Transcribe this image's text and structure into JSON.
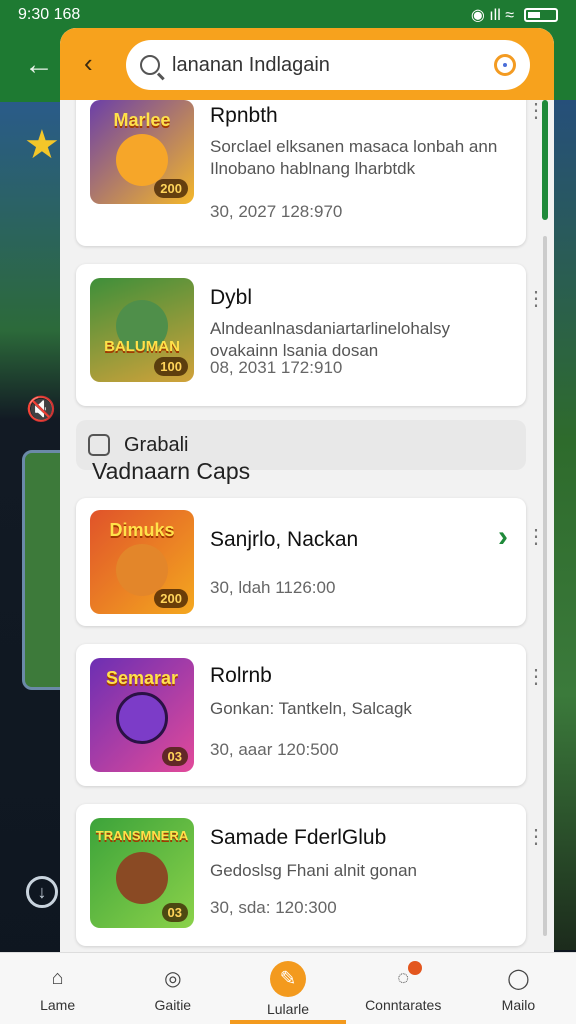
{
  "status_bar": {
    "time": "9:30 168",
    "indicators": "◉ ıll ≈"
  },
  "search": {
    "back_label": "‹",
    "query": "lananan Indlagain"
  },
  "results": [
    {
      "title": "Rpnbth",
      "desc": "Sorclael elksanen masaca lonbah ann Ilnobano hablnang lharbtdk",
      "meta": "30, 2027 128:970",
      "art_title": "Marlee",
      "badge": "200",
      "colors": [
        "#6b3fa8",
        "#f4b72a"
      ]
    },
    {
      "title": "Dybl",
      "desc": "Alndeanlnasdaniartarlinelohalsy ovakainn lsania dosan",
      "meta": "08, 2031 172:910",
      "art_title": "BALUMAN",
      "badge": "100",
      "colors": [
        "#3e8f3a",
        "#d1a23a"
      ]
    }
  ],
  "filter": {
    "checkbox_label": "Grabali"
  },
  "section": {
    "title": "Vadnaarn Caps"
  },
  "apps": [
    {
      "title": "Sanjrlo, Nackan",
      "desc": "",
      "meta": "30, ldah 1126:00",
      "art_title": "Dimuks",
      "badge": "200",
      "colors": [
        "#e0532a",
        "#f4a81f"
      ]
    },
    {
      "title": "Rolrnb",
      "desc": "Gonkan: Tantkeln, Salcagk",
      "meta": "30, aaar 120:500",
      "art_title": "Semarar",
      "badge": "03",
      "colors": [
        "#6c2fb3",
        "#e24a9a"
      ]
    },
    {
      "title": "Samade FderlGlub",
      "desc": "Gedoslsg Fhani alnit gonan",
      "meta": "30, sda: 120:300",
      "art_title": "TRANSMNERA",
      "badge": "03",
      "colors": [
        "#3ca33a",
        "#8bd24a"
      ]
    }
  ],
  "nav": [
    {
      "label": "Lame",
      "icon": "home-icon"
    },
    {
      "label": "Gaitie",
      "icon": "target-icon"
    },
    {
      "label": "Lularle",
      "icon": "pen-icon"
    },
    {
      "label": "Conntarates",
      "icon": "chat-icon"
    },
    {
      "label": "Mailo",
      "icon": "profile-icon"
    }
  ]
}
